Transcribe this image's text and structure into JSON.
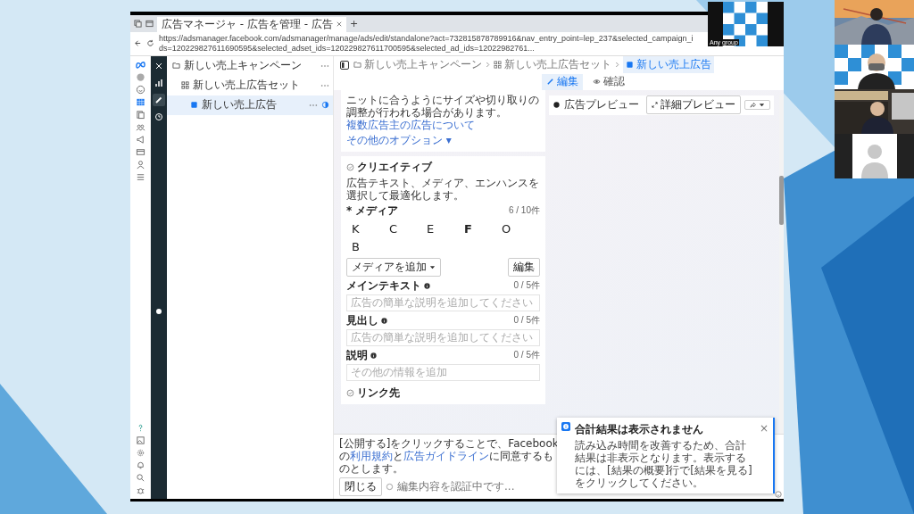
{
  "browser": {
    "tab_title": "広告マネージャ - 広告を管理 - 広告",
    "new_tab": "+",
    "url": "https://adsmanager.facebook.com/adsmanager/manage/ads/edit/standalone?act=732815878789916&nav_entry_point=lep_237&selected_campaign_ids=120229827611690595&selected_adset_ids=120229827611700595&selected_ad_ids=12022982761..."
  },
  "tree": [
    {
      "label": "新しい売上キャンペーン",
      "kind": "campaign",
      "selected": false,
      "children": [
        {
          "label": "新しい売上広告セット",
          "kind": "adset",
          "selected": false,
          "children": [
            {
              "label": "新しい売上広告",
              "kind": "ad",
              "selected": true
            }
          ]
        }
      ]
    }
  ],
  "breadcrumb": [
    {
      "label": "新しい売上キャンペーン",
      "kind": "campaign"
    },
    {
      "label": "新しい売上広告セット",
      "kind": "adset"
    },
    {
      "label": "新しい売上広告",
      "kind": "ad"
    }
  ],
  "modes": [
    {
      "label": "編集",
      "kind": "edit",
      "selected": true
    },
    {
      "label": "確認",
      "kind": "review",
      "selected": false
    }
  ],
  "placement_note": {
    "text": "ニットに合うようにサイズや切り取りの調整が行われる場合があります。",
    "link": "複数広告主の広告について"
  },
  "more_options": "その他のオプション ▾",
  "creative": {
    "title": "クリエイティブ",
    "description": "広告テキスト、メディア、エンハンスを選択して最適化します。",
    "media_label": "* メディア",
    "media_count": "6 / 10件",
    "media": [
      {
        "label": "K",
        "bold": false
      },
      {
        "label": "C",
        "bold": false
      },
      {
        "label": "E",
        "bold": false
      },
      {
        "label": "F",
        "bold": true
      },
      {
        "label": "O",
        "bold": false
      },
      {
        "label": "B",
        "bold": false
      }
    ],
    "add_media": "メディアを追加",
    "edit": "編集",
    "fields": [
      {
        "label": "メインテキスト",
        "count": "0 / 5件",
        "placeholder": "広告の簡単な説明を追加してください"
      },
      {
        "label": "見出し",
        "count": "0 / 5件",
        "placeholder": "広告の簡単な説明を追加してください"
      },
      {
        "label": "説明",
        "count": "0 / 5件",
        "placeholder": "その他の情報を追加"
      }
    ]
  },
  "next_section": "リンク先",
  "preview": {
    "title": "広告プレビュー",
    "detail_button": "詳細プレビュー"
  },
  "footer": {
    "parts": [
      {
        "text": "[公開する]をクリックすることで、Facebookの",
        "link": false
      },
      {
        "text": "利用規約",
        "link": true
      },
      {
        "text": "と",
        "link": false
      },
      {
        "text": "広告ガイドライン",
        "link": true
      },
      {
        "text": "に同意するものとします。",
        "link": false
      }
    ],
    "close": "閉じる",
    "status": "編集内容を認証中です..."
  },
  "toast": {
    "title": "合計結果は表示されません",
    "body": "読み込み時間を改善するため、合計結果は非表示となります。表示するには、[結果の概要]行で[結果を見る]をクリックしてください。",
    "close": "×"
  },
  "floating_video": {
    "label": "Any group"
  }
}
